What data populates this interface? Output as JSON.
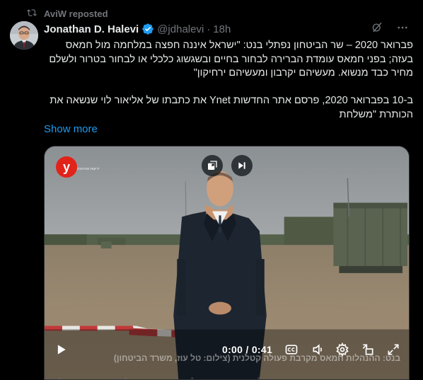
{
  "repost": {
    "text": "AviW reposted",
    "icon": "repost-icon"
  },
  "author": {
    "name": "Jonathan D. Halevi",
    "verified_icon": "verified-badge-icon",
    "handle": "@jdhalevi",
    "separator": "·",
    "time": "18h"
  },
  "header_icons": [
    "grok-icon",
    "more-icon"
  ],
  "tweet": {
    "paragraph1": "פברואר 2020 – שר הביטחון נפתלי בנט: \"ישראל איננה חפצה במלחמה מול חמאס בעזה; בפני חמאס עומדת הברירה לבחור בחיים ובשגשוג כלכלי או לבחור בטרור ולשלם מחיר כבד מנשוא. מעשיהם יקרבון ומעשיהם ירחיקון\"",
    "paragraph2": "ב-10 בפברואר 2020, פרסם אתר החדשות Ynet את כתבתו של אליאור לוי שנשאה את הכותרת \"משלחת",
    "show_more": "Show more"
  },
  "video": {
    "brand_letter": "y",
    "brand_sub": "ידיעות אחרונות",
    "overlay_buttons": [
      "picture-in-picture-icon",
      "skip-next-icon"
    ],
    "time_current": "0:00",
    "time_separator": "/",
    "time_total": "0:41",
    "caption": "בנט: ההנהלות חמאס מקרבת פעולה קטלנית (צילום: טל עוז, משרד הביטחון)",
    "controls": [
      "play-icon",
      "captions-icon",
      "volume-icon",
      "settings-icon",
      "collapse-icon",
      "fullscreen-icon"
    ],
    "accent": "#1d9bf0"
  },
  "colors": {
    "background": "#000000",
    "text": "#e7e9ea",
    "muted": "#71767b",
    "link": "#1d9bf0"
  }
}
